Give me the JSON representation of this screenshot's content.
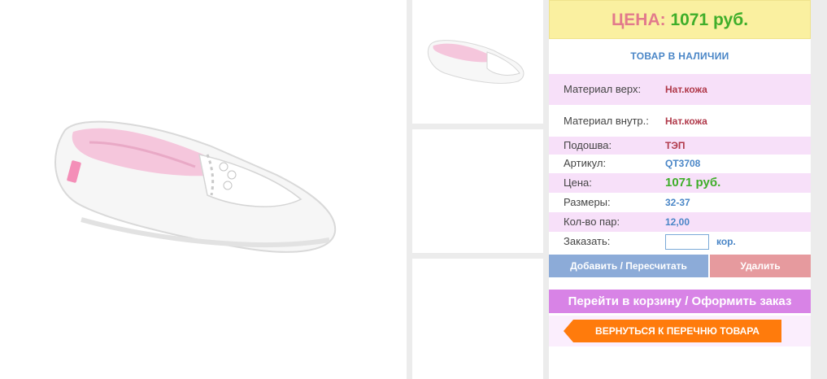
{
  "price_header": {
    "label": "ЦЕНА:",
    "value": "1071 руб."
  },
  "stock_status": "ТОВАР В НАЛИЧИИ",
  "specs": [
    {
      "key": "Материал верх:",
      "value": "Нат.кожа"
    },
    {
      "key": "Материал внутр.:",
      "value": "Нат.кожа"
    },
    {
      "key": "Подошва:",
      "value": "ТЭП"
    },
    {
      "key": "Артикул:",
      "value": "QT3708"
    },
    {
      "key": "Цена:",
      "value": "1071 руб."
    },
    {
      "key": "Размеры:",
      "value": "32-37"
    },
    {
      "key": "Кол-во пар:",
      "value": "12,00"
    }
  ],
  "order": {
    "label": "Заказать:",
    "value": "",
    "unit": "кор."
  },
  "buttons": {
    "add": "Добавить / Пересчитать",
    "delete": "Удалить",
    "cart": "Перейти в корзину / Оформить заказ",
    "back": "ВЕРНУТЬСЯ К ПЕРЕЧНЮ ТОВАРА"
  },
  "colors": {
    "price_bg": "#faf0a0",
    "price_label": "#e27a8c",
    "price_value": "#3fae2a",
    "row_highlight": "#f7e0f9",
    "add_button": "#8cabd8",
    "delete_button": "#e69a9e",
    "cart_button": "#d883e6",
    "back_button": "#ff7b0c"
  }
}
